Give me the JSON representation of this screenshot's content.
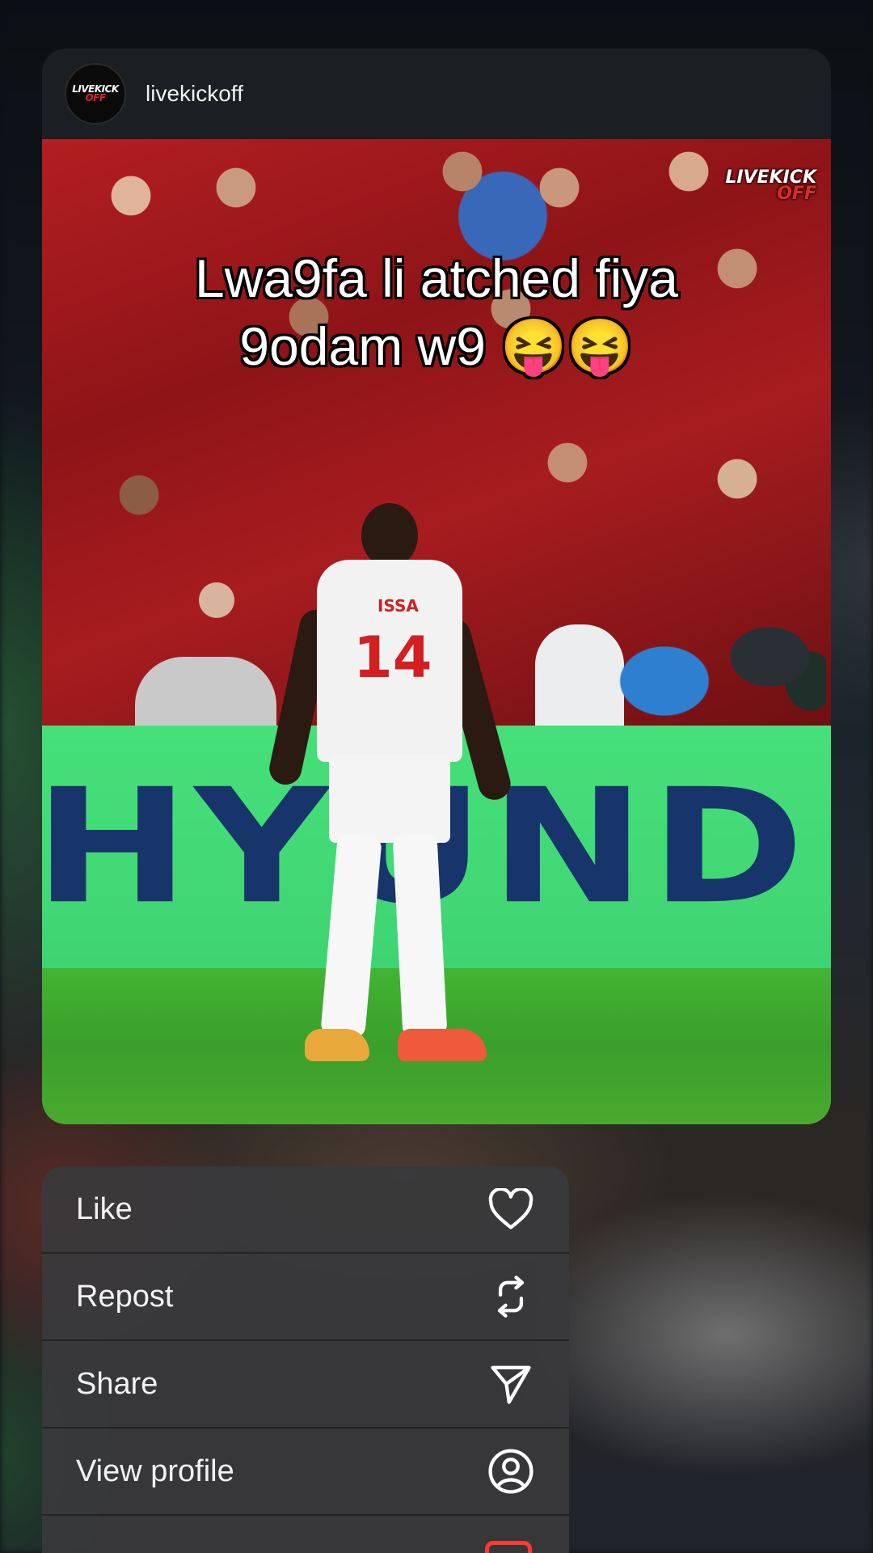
{
  "post": {
    "username": "livekickoff",
    "avatar_logo_line1": "LIVEKICK",
    "avatar_logo_line2": "OFF",
    "caption_line1": "Lwa9fa li atched fiya",
    "caption_line2": "9odam w9 😝😝",
    "watermark_line1": "LIVEKICK",
    "watermark_line2": "OFF",
    "board_text": "HYUND",
    "jersey_name": "ISSA",
    "jersey_number": "14"
  },
  "menu": {
    "items": [
      {
        "label": "Like",
        "icon": "heart-icon"
      },
      {
        "label": "Repost",
        "icon": "repost-icon"
      },
      {
        "label": "Share",
        "icon": "send-icon"
      },
      {
        "label": "View profile",
        "icon": "profile-icon"
      }
    ],
    "partial_item_icon": "report-icon",
    "partial_icon_color": "#ff3b30"
  }
}
